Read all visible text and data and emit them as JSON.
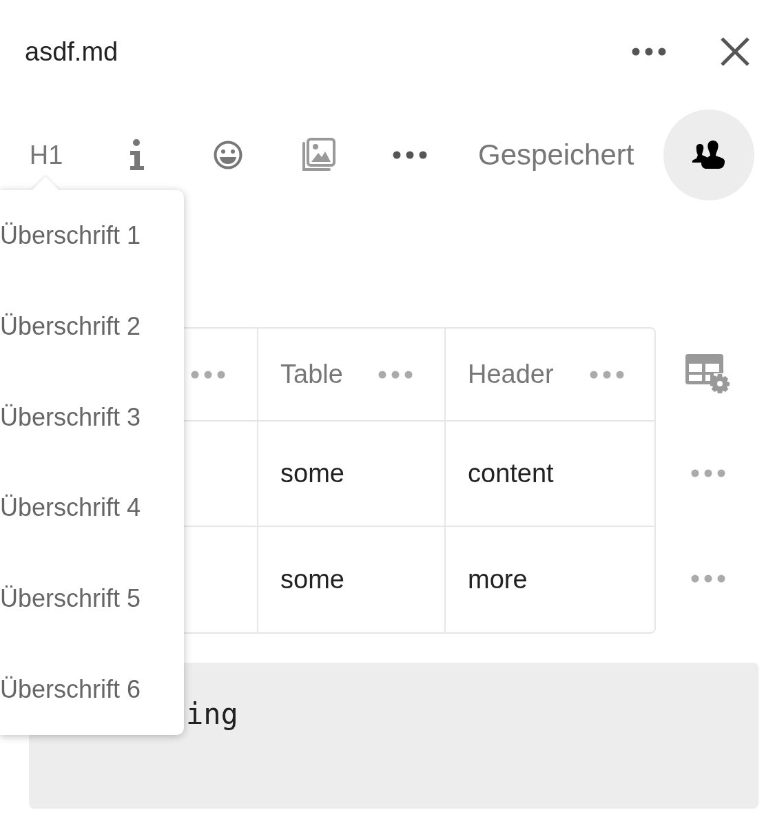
{
  "header": {
    "title": "asdf.md"
  },
  "toolbar": {
    "heading_button": "H1",
    "status": "Gespeichert"
  },
  "heading_menu": {
    "items": [
      "Überschrift 1",
      "Überschrift 2",
      "Überschrift 3",
      "Überschrift 4",
      "Überschrift 5",
      "Überschrift 6"
    ]
  },
  "table": {
    "columns": [
      {
        "label": "Table"
      },
      {
        "label": "Header"
      }
    ],
    "rows": [
      {
        "cells": [
          "some",
          "content"
        ]
      },
      {
        "cells": [
          "some",
          "more"
        ]
      }
    ]
  },
  "code_block": {
    "text": "ing"
  }
}
